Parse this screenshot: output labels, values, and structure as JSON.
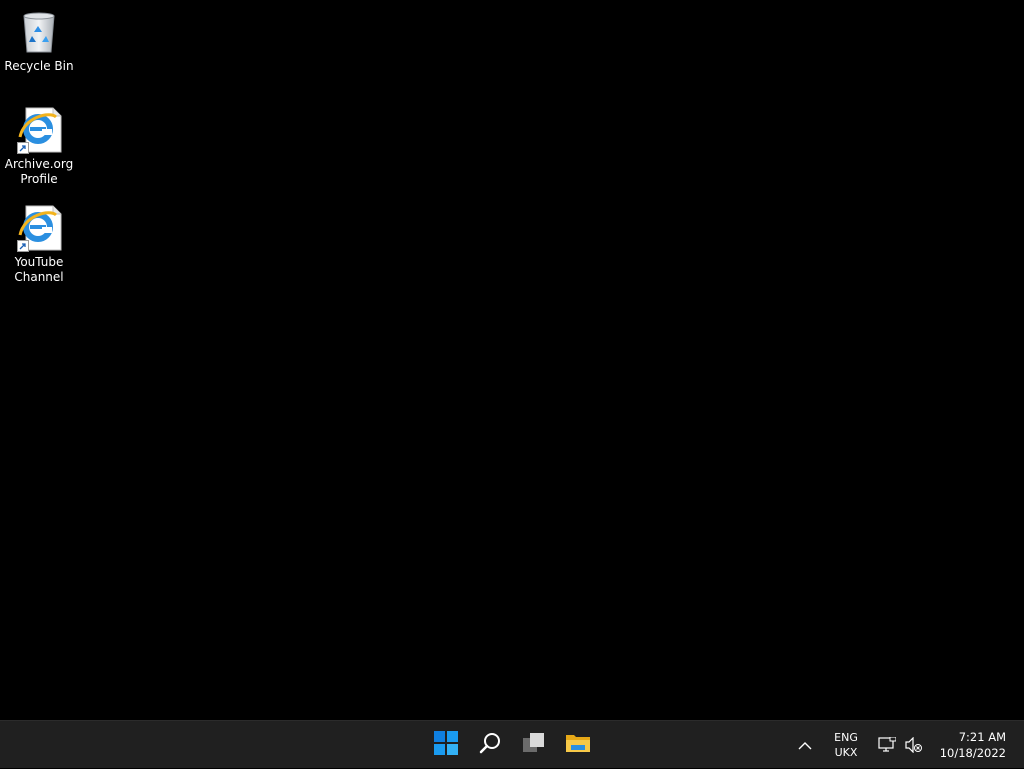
{
  "desktop": {
    "icons": [
      {
        "label": "Recycle Bin",
        "icon": "recycle-bin-icon"
      },
      {
        "label": "Archive.org\nProfile",
        "icon": "internet-explorer-icon"
      },
      {
        "label": "YouTube\nChannel",
        "icon": "internet-explorer-icon"
      }
    ]
  },
  "taskbar": {
    "pinned": [
      {
        "name": "Start",
        "icon": "windows-logo-icon"
      },
      {
        "name": "Search",
        "icon": "search-icon"
      },
      {
        "name": "Task View",
        "icon": "task-view-icon"
      },
      {
        "name": "File Explorer",
        "icon": "folder-icon"
      }
    ],
    "tray": {
      "language_line1": "ENG",
      "language_line2": "UKX",
      "time": "7:21 AM",
      "date": "10/18/2022",
      "icons": [
        "chevron-up-icon",
        "network-icon",
        "volume-muted-icon"
      ]
    }
  },
  "colors": {
    "desktop_background": "#000000",
    "taskbar_background": "#202020",
    "accent": "#0f7fe0",
    "folder_yellow": "#f7c948"
  }
}
